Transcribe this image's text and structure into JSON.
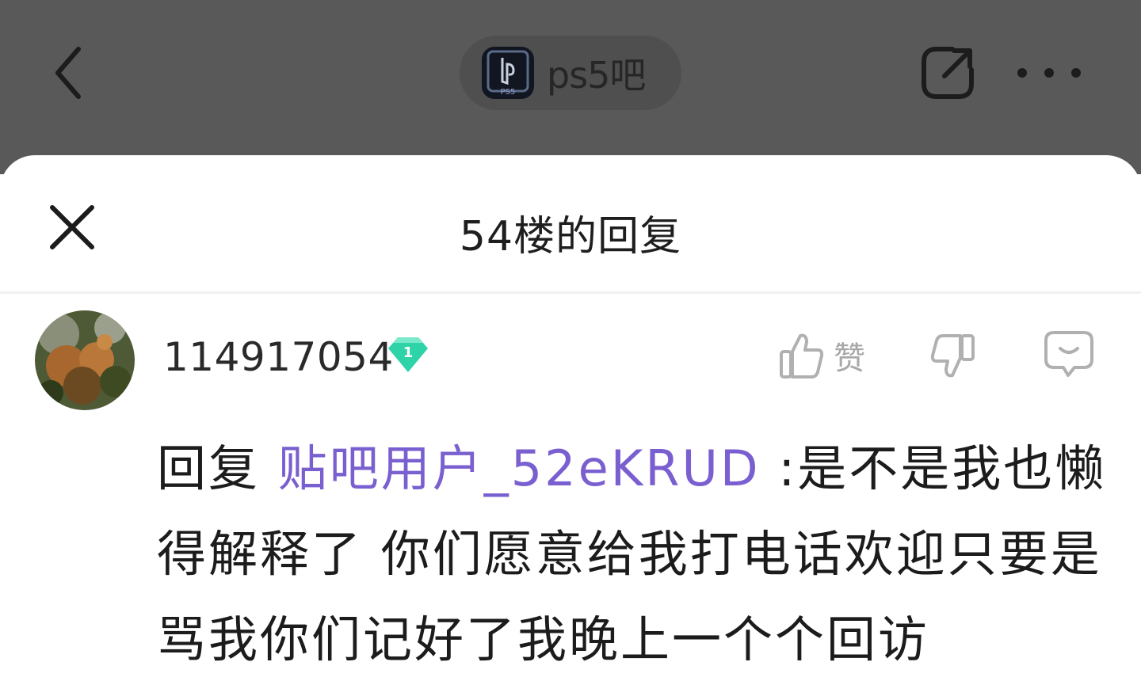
{
  "header": {
    "forum_name": "ps5吧",
    "logo_text": "PS5"
  },
  "sheet": {
    "title": "54楼的回复"
  },
  "post": {
    "username": "114917054",
    "level": "1",
    "like_label": "赞",
    "reply_prefix": "回复",
    "mention": "贴吧用户_52eKRUD",
    "body": " :是不是我也懒得解释了 你们愿意给我打电话欢迎只要是骂我你们记好了我晚上一个个回访"
  },
  "colors": {
    "topbar_bg": "#595959",
    "mention": "#7a5fd0",
    "level_badge": "#2ed3a8",
    "icon_gray": "#b0b0b0"
  },
  "icons": [
    "back-icon",
    "share-icon",
    "more-icon",
    "close-icon",
    "like-icon",
    "dislike-icon",
    "reply-icon"
  ]
}
